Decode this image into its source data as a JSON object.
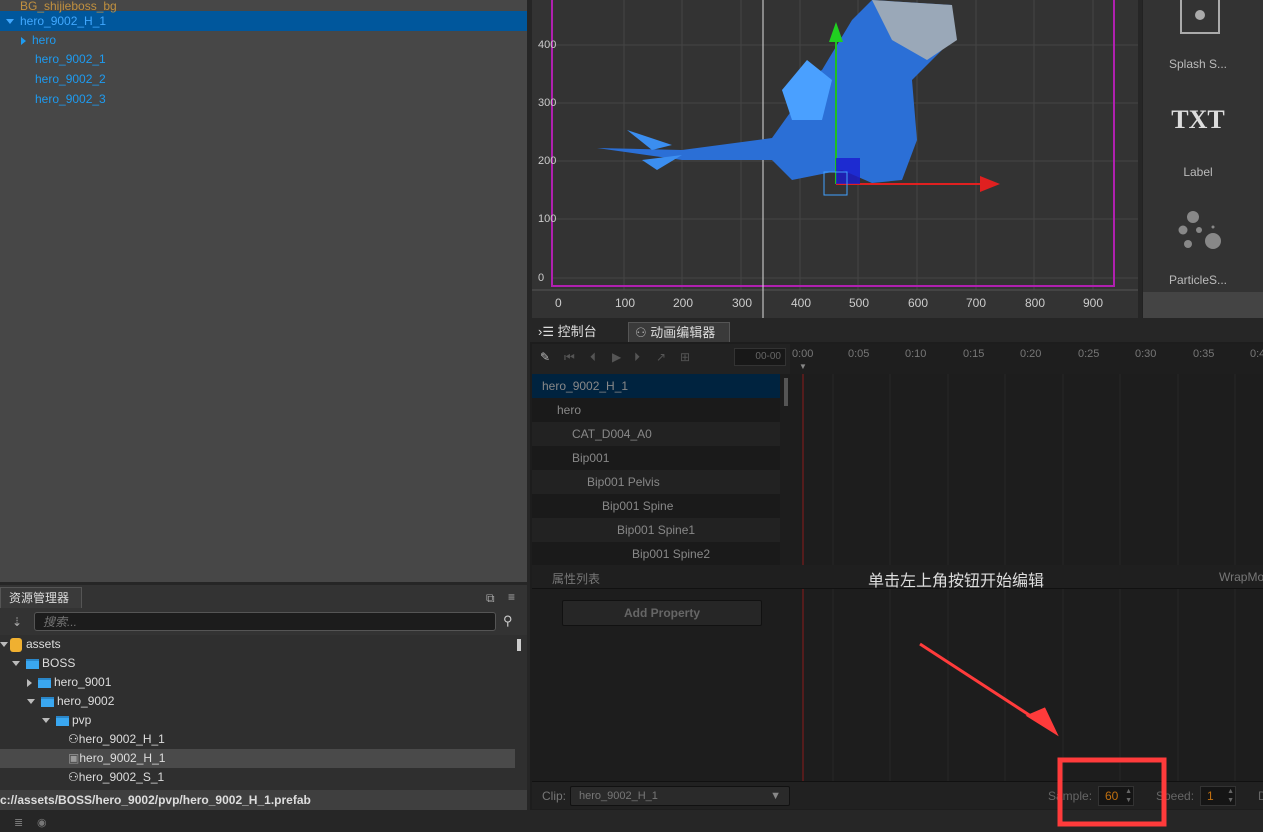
{
  "hierarchy": {
    "partial_top": "BG_shijieboss_bg",
    "items": [
      {
        "label": "hero_9002_H_1",
        "expanded": true,
        "selected": true
      },
      {
        "label": "hero",
        "expanded": false
      },
      {
        "label": "hero_9002_1"
      },
      {
        "label": "hero_9002_2"
      },
      {
        "label": "hero_9002_3"
      }
    ]
  },
  "scene": {
    "y_ticks": [
      "400",
      "300",
      "200",
      "100",
      "0"
    ],
    "x_ticks": [
      "0",
      "100",
      "200",
      "300",
      "400",
      "500",
      "600",
      "700",
      "800",
      "900"
    ]
  },
  "library": {
    "items": [
      {
        "label": "Splash S...",
        "icon": "splash-sprite-icon"
      },
      {
        "label": "Label",
        "icon": "txt-icon",
        "glyph": "TXT"
      },
      {
        "label": "ParticleS...",
        "icon": "particle-icon"
      }
    ]
  },
  "animation": {
    "tabs": [
      {
        "label": "控制台",
        "icon": "console-icon"
      },
      {
        "label": "动画编辑器",
        "icon": "animation-icon",
        "active": true
      }
    ],
    "time_value": "00-00",
    "ticks": [
      "0:00",
      "0:05",
      "0:10",
      "0:15",
      "0:20",
      "0:25",
      "0:30",
      "0:35",
      "0:4"
    ],
    "nodes": [
      "hero_9002_H_1",
      "hero",
      "CAT_D004_A0",
      "Bip001",
      "Bip001 Pelvis",
      "Bip001 Spine",
      "Bip001 Spine1",
      "Bip001 Spine2"
    ],
    "property_list_label": "属性列表",
    "hint": "单击左上角按钮开始编辑",
    "wrapmode_label": "WrapMo",
    "add_property": "Add Property",
    "clip_label": "Clip:",
    "clip_value": "hero_9002_H_1",
    "sample_label": "Sample:",
    "sample_value": "60",
    "speed_label": "Speed:",
    "speed_value": "1",
    "cut_label": "D"
  },
  "assets": {
    "tab": "资源管理器",
    "search_placeholder": "搜索...",
    "tree": [
      {
        "label": "assets",
        "type": "root"
      },
      {
        "label": "BOSS",
        "type": "folder"
      },
      {
        "label": "hero_9001",
        "type": "folder"
      },
      {
        "label": "hero_9002",
        "type": "folder"
      },
      {
        "label": "pvp",
        "type": "folder"
      },
      {
        "label": "hero_9002_H_1",
        "type": "animation-clip"
      },
      {
        "label": "hero_9002_H_1",
        "type": "prefab",
        "selected": true
      },
      {
        "label": "hero_9002_S_1",
        "type": "animation-clip"
      }
    ],
    "path": "c://assets/BOSS/hero_9002/pvp/hero_9002_H_1.prefab"
  },
  "colors": {
    "selection": "#00579c",
    "annotation": "#ff3b3b",
    "sample_value": "#c07010"
  }
}
